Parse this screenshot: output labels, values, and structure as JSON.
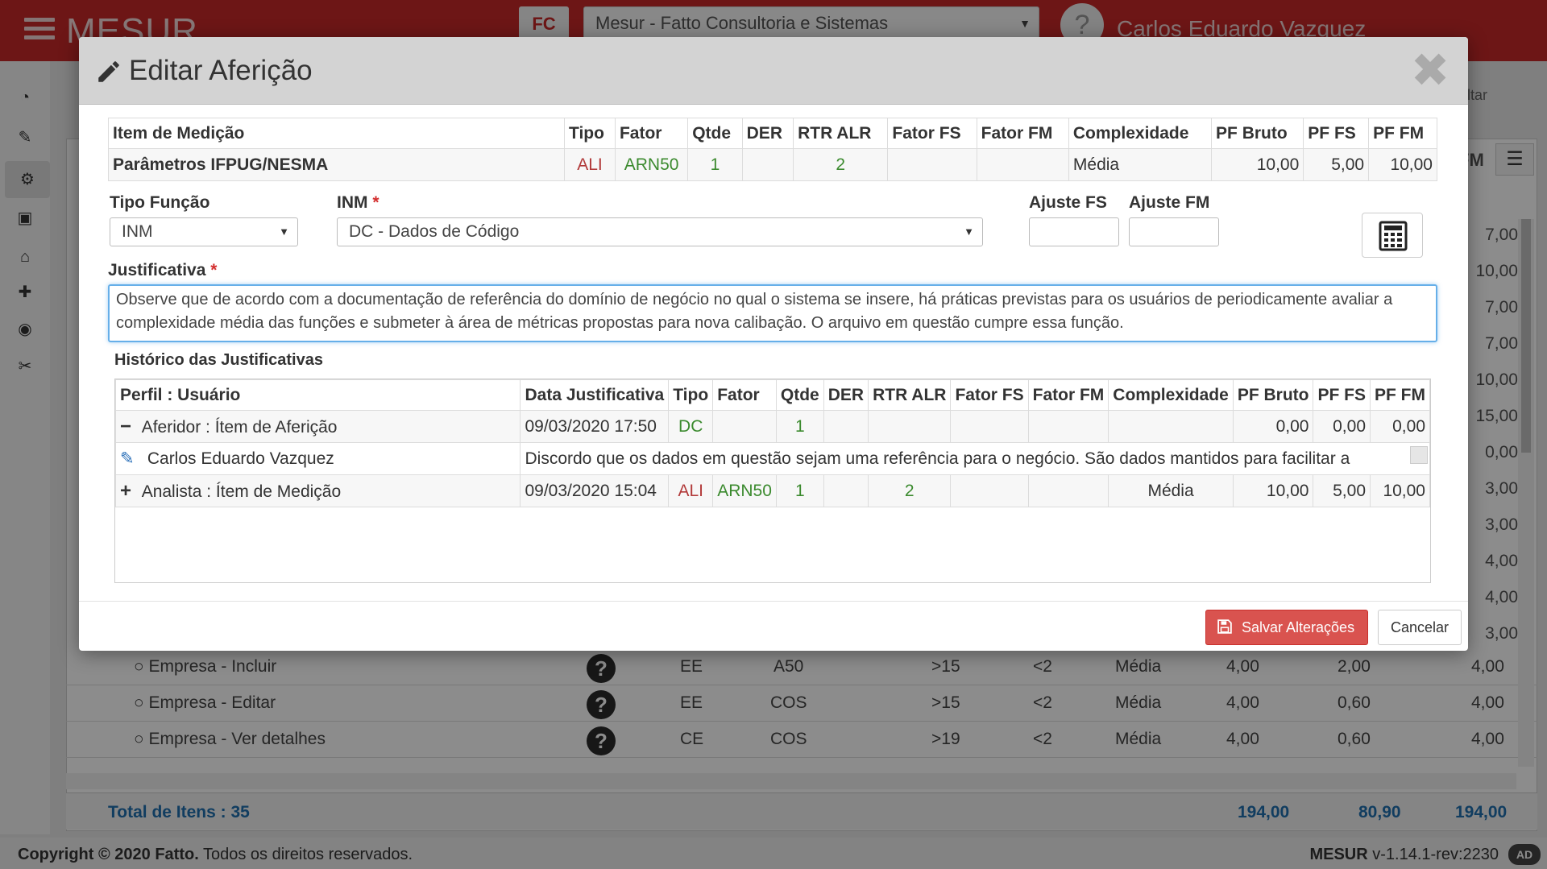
{
  "app": {
    "brand": "MESUR",
    "org_select": "Mesur - Fatto Consultoria e Sistemas",
    "user_name": "Carlos Eduardo Vazquez",
    "voltar_label": "Voltar",
    "pf_header": "FM",
    "background_pf": [
      "7,00",
      "10,00",
      "7,00",
      "7,00",
      "10,00",
      "15,00",
      "0,00",
      "3,00",
      "3,00",
      "4,00",
      "4,00",
      "3,00"
    ],
    "background_rows": [
      {
        "name": "Empresa - Incluir",
        "tipo": "EE",
        "fator": "A50",
        "der": ">15",
        "rtr": "<2",
        "complex": "Média",
        "pf_bruto": "4,00",
        "pf_fs": "2,00",
        "pf_fm": "4,00"
      },
      {
        "name": "Empresa - Editar",
        "tipo": "EE",
        "fator": "COS",
        "der": ">15",
        "rtr": "<2",
        "complex": "Média",
        "pf_bruto": "4,00",
        "pf_fs": "0,60",
        "pf_fm": "4,00"
      },
      {
        "name": "Empresa - Ver detalhes",
        "tipo": "CE",
        "fator": "COS",
        "der": ">19",
        "rtr": "<2",
        "complex": "Média",
        "pf_bruto": "4,00",
        "pf_fs": "0,60",
        "pf_fm": "4,00"
      }
    ],
    "total_label": "Total de Itens : 35",
    "total_pf_bruto": "194,00",
    "total_pf_fs": "80,90",
    "total_pf_fm": "194,00",
    "footer_left_bold": "Copyright © 2020 Fatto.",
    "footer_left": " Todos os direitos reservados.",
    "footer_right_bold": "MESUR",
    "footer_right": " v-1.14.1-rev:2230",
    "footer_badge": "AD"
  },
  "modal": {
    "title": "Editar Aferição",
    "top_table": {
      "headers": [
        "Item de Medição",
        "Tipo",
        "Fator",
        "Qtde",
        "DER",
        "RTR ALR",
        "Fator FS",
        "Fator FM",
        "Complexidade",
        "PF Bruto",
        "PF FS",
        "PF FM"
      ],
      "row": {
        "item": "Parâmetros IFPUG/NESMA",
        "tipo": "ALI",
        "fator": "ARN50",
        "qtde": "1",
        "der": "",
        "rtr": "2",
        "fator_fs": "",
        "fator_fm": "",
        "complexidade": "Média",
        "pf_bruto": "10,00",
        "pf_fs": "5,00",
        "pf_fm": "10,00"
      }
    },
    "form": {
      "tipo_funcao_label": "Tipo Função",
      "tipo_funcao_value": "INM",
      "inm_label": "INM",
      "inm_value": "DC - Dados de Código",
      "ajuste_fs_label": "Ajuste FS",
      "ajuste_fm_label": "Ajuste FM",
      "required_mark": "*",
      "justificativa_label": "Justificativa",
      "justificativa_value": "Observe que de acordo com a documentação de referência do domínio de negócio no qual o sistema se insere, há práticas previstas para os usuários de periodicamente avaliar a complexidade média das funções e submeter à área de métricas propostas para nova calibação. O arquivo em questão cumpre essa função."
    },
    "history": {
      "title": "Histórico das Justificativas",
      "headers": [
        "Perfil : Usuário",
        "Data Justificativa",
        "Tipo",
        "Fator",
        "Qtde",
        "DER",
        "RTR ALR",
        "Fator FS",
        "Fator FM",
        "Complexidade",
        "PF Bruto",
        "PF FS",
        "PF FM"
      ],
      "rows": [
        {
          "symbol": "−",
          "perfil": "Aferidor : Ítem de Aferição",
          "data": "09/03/2020 17:50",
          "tipo": "DC",
          "fator": "",
          "qtde": "1",
          "der": "",
          "rtr": "",
          "fator_fs": "",
          "fator_fm": "",
          "complexidade": "",
          "pf_bruto": "0,00",
          "pf_fs": "0,00",
          "pf_fm": "0,00"
        },
        {
          "symbol": "+",
          "perfil": "Analista : Ítem de Medição",
          "data": "09/03/2020 15:04",
          "tipo": "ALI",
          "fator": "ARN50",
          "qtde": "1",
          "der": "",
          "rtr": "2",
          "fator_fs": "",
          "fator_fm": "",
          "complexidade": "Média",
          "pf_bruto": "10,00",
          "pf_fs": "5,00",
          "pf_fm": "10,00"
        }
      ],
      "note_user": "Carlos Eduardo Vazquez",
      "note_text": "Discordo que os dados em questão sejam uma referência para o negócio. São dados mantidos para facilitar a"
    },
    "save_label": "Salvar Alterações",
    "cancel_label": "Cancelar"
  },
  "colors": {
    "brand_red": "#c62828",
    "save_red": "#d9534f",
    "focus_blue": "#66afe9",
    "value_red": "#b23a3a",
    "value_green": "#3b8a2e",
    "total_blue": "#1f6fb0"
  }
}
